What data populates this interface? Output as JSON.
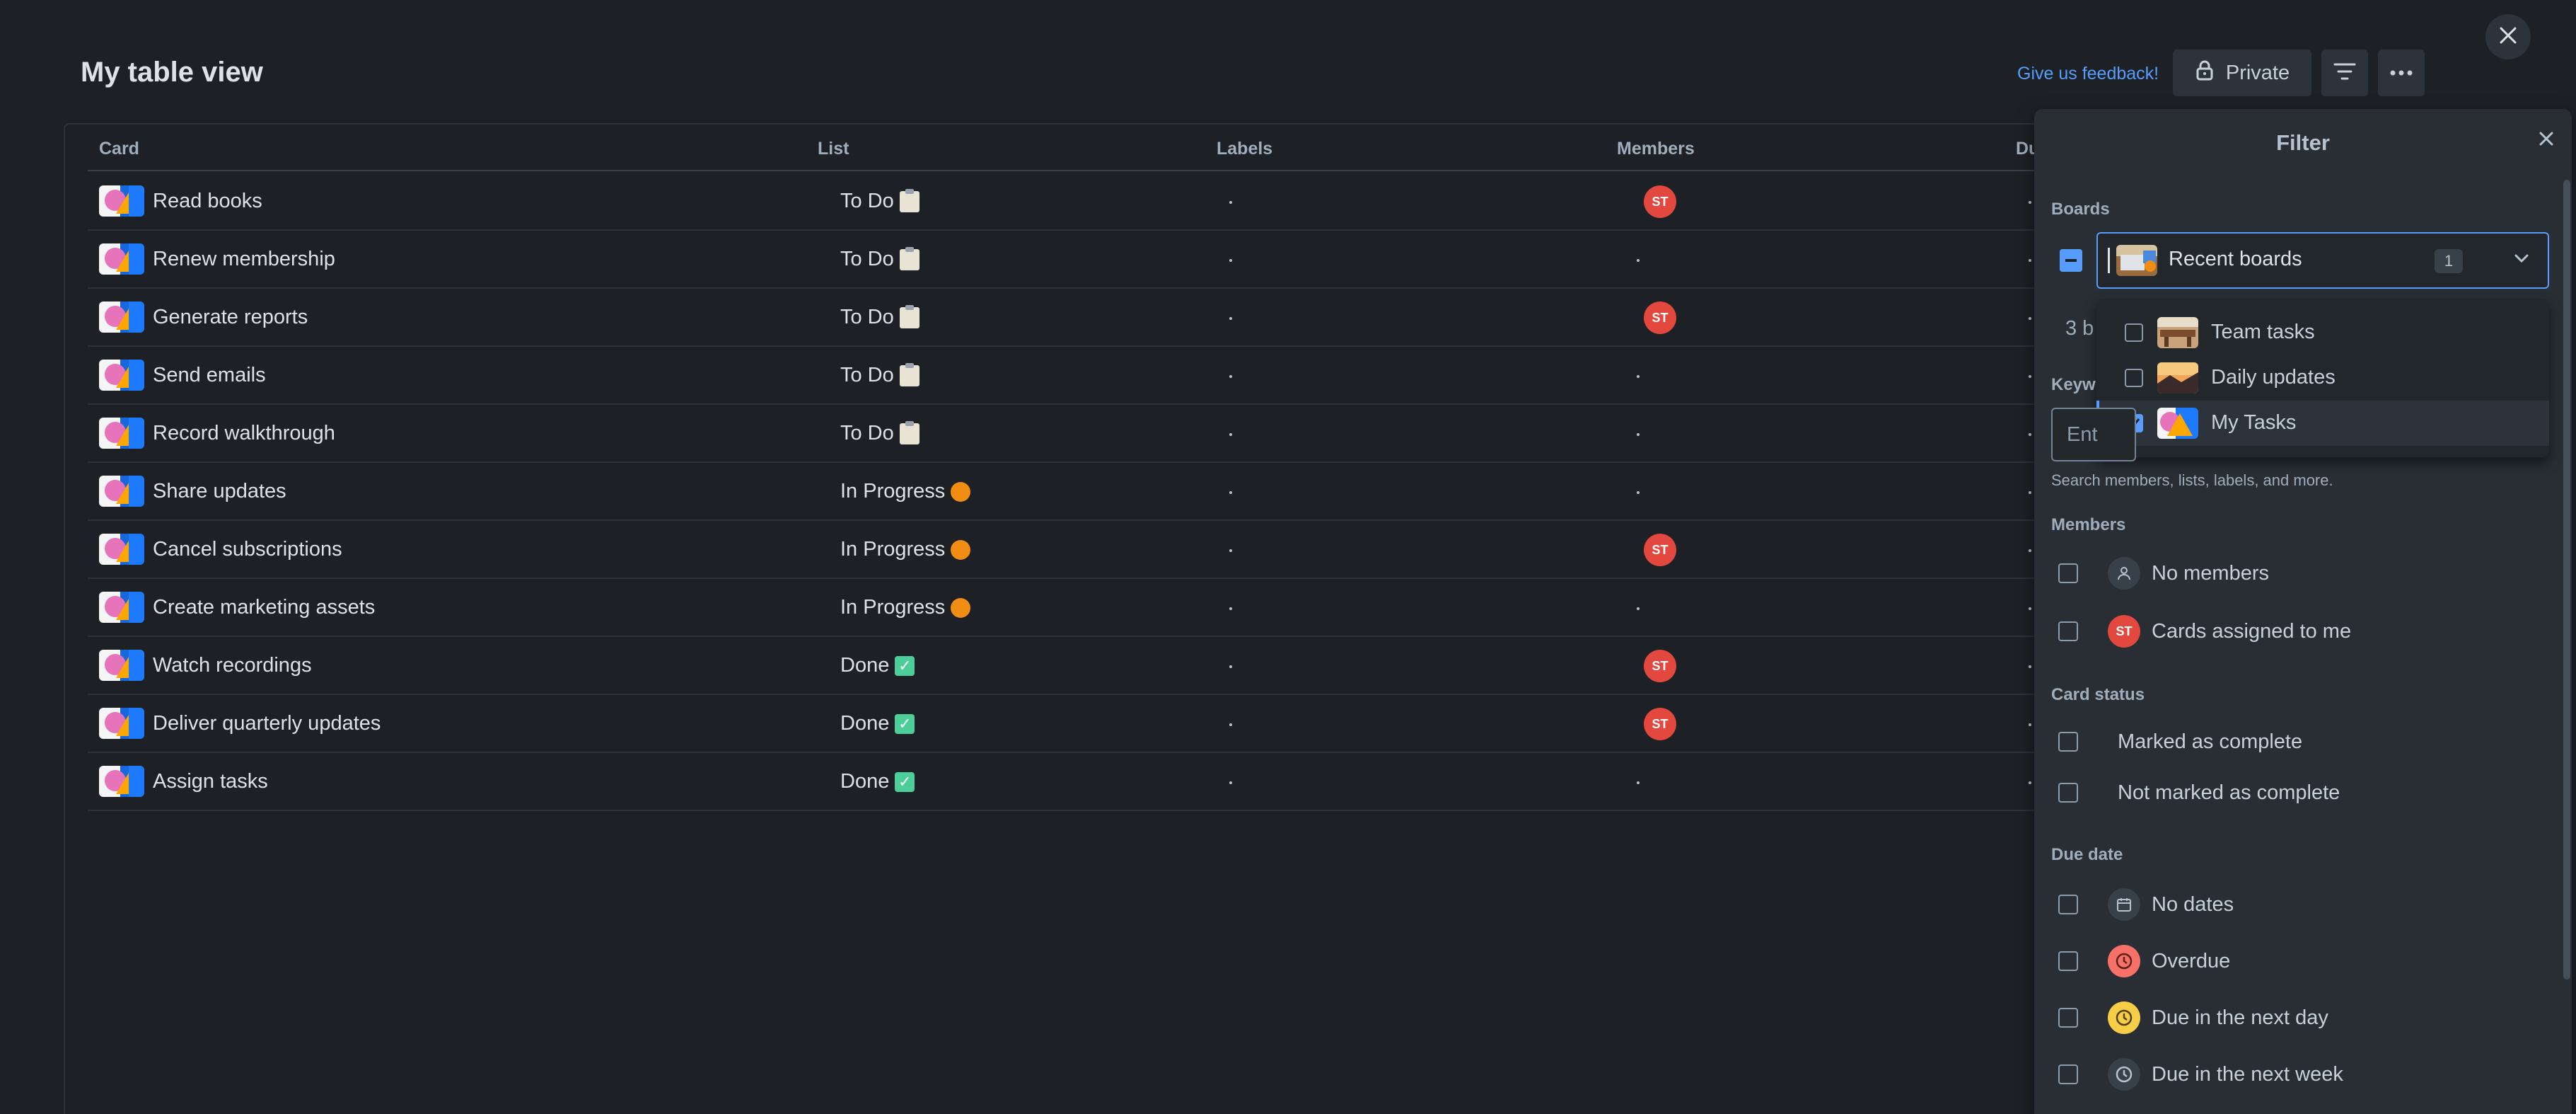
{
  "header": {
    "title": "My table view",
    "feedback_link": "Give us feedback!",
    "private_label": "Private",
    "filter_icon": "filter-icon",
    "more_icon": "more-icon",
    "close_icon": "close-icon"
  },
  "table": {
    "columns": [
      "Card",
      "List",
      "Labels",
      "Members",
      "Du"
    ],
    "rows": [
      {
        "card": "Read books",
        "list": "To Do",
        "list_emoji": "clipboard",
        "labels": "·",
        "member": "ST"
      },
      {
        "card": "Renew membership",
        "list": "To Do",
        "list_emoji": "clipboard",
        "labels": "·",
        "member": "·"
      },
      {
        "card": "Generate reports",
        "list": "To Do",
        "list_emoji": "clipboard",
        "labels": "·",
        "member": "ST"
      },
      {
        "card": "Send emails",
        "list": "To Do",
        "list_emoji": "clipboard",
        "labels": "·",
        "member": "·"
      },
      {
        "card": "Record walkthrough",
        "list": "To Do",
        "list_emoji": "clipboard",
        "labels": "·",
        "member": "·"
      },
      {
        "card": "Share updates",
        "list": "In Progress",
        "list_emoji": "orange-circle",
        "labels": "·",
        "member": "·"
      },
      {
        "card": "Cancel subscriptions",
        "list": "In Progress",
        "list_emoji": "orange-circle",
        "labels": "·",
        "member": "ST"
      },
      {
        "card": "Create marketing assets",
        "list": "In Progress",
        "list_emoji": "orange-circle",
        "labels": "·",
        "member": "·"
      },
      {
        "card": "Watch recordings",
        "list": "Done",
        "list_emoji": "check-mark",
        "labels": "·",
        "member": "ST"
      },
      {
        "card": "Deliver quarterly updates",
        "list": "Done",
        "list_emoji": "check-mark",
        "labels": "·",
        "member": "ST"
      },
      {
        "card": "Assign tasks",
        "list": "Done",
        "list_emoji": "check-mark",
        "labels": "·",
        "member": "·"
      }
    ]
  },
  "filter": {
    "title": "Filter",
    "boards": {
      "label": "Boards",
      "selected": "Recent boards",
      "count": "1",
      "peek_text": "3 b",
      "options": [
        {
          "label": "Team tasks",
          "checked": false
        },
        {
          "label": "Daily updates",
          "checked": false
        },
        {
          "label": "My Tasks",
          "checked": true
        }
      ]
    },
    "keyword": {
      "label": "Keyw",
      "placeholder": "Ent",
      "hint": "Search members, lists, labels, and more."
    },
    "members": {
      "label": "Members",
      "options": [
        "No members",
        "Cards assigned to me"
      ],
      "avatar": "ST"
    },
    "card_status": {
      "label": "Card status",
      "options": [
        "Marked as complete",
        "Not marked as complete"
      ]
    },
    "due_date": {
      "label": "Due date",
      "options": [
        "No dates",
        "Overdue",
        "Due in the next day",
        "Due in the next week"
      ]
    }
  },
  "colors": {
    "accent": "#579dff",
    "avatar": "#e2483d",
    "overdue": "#f87168",
    "due_soon": "#f5cd47"
  }
}
